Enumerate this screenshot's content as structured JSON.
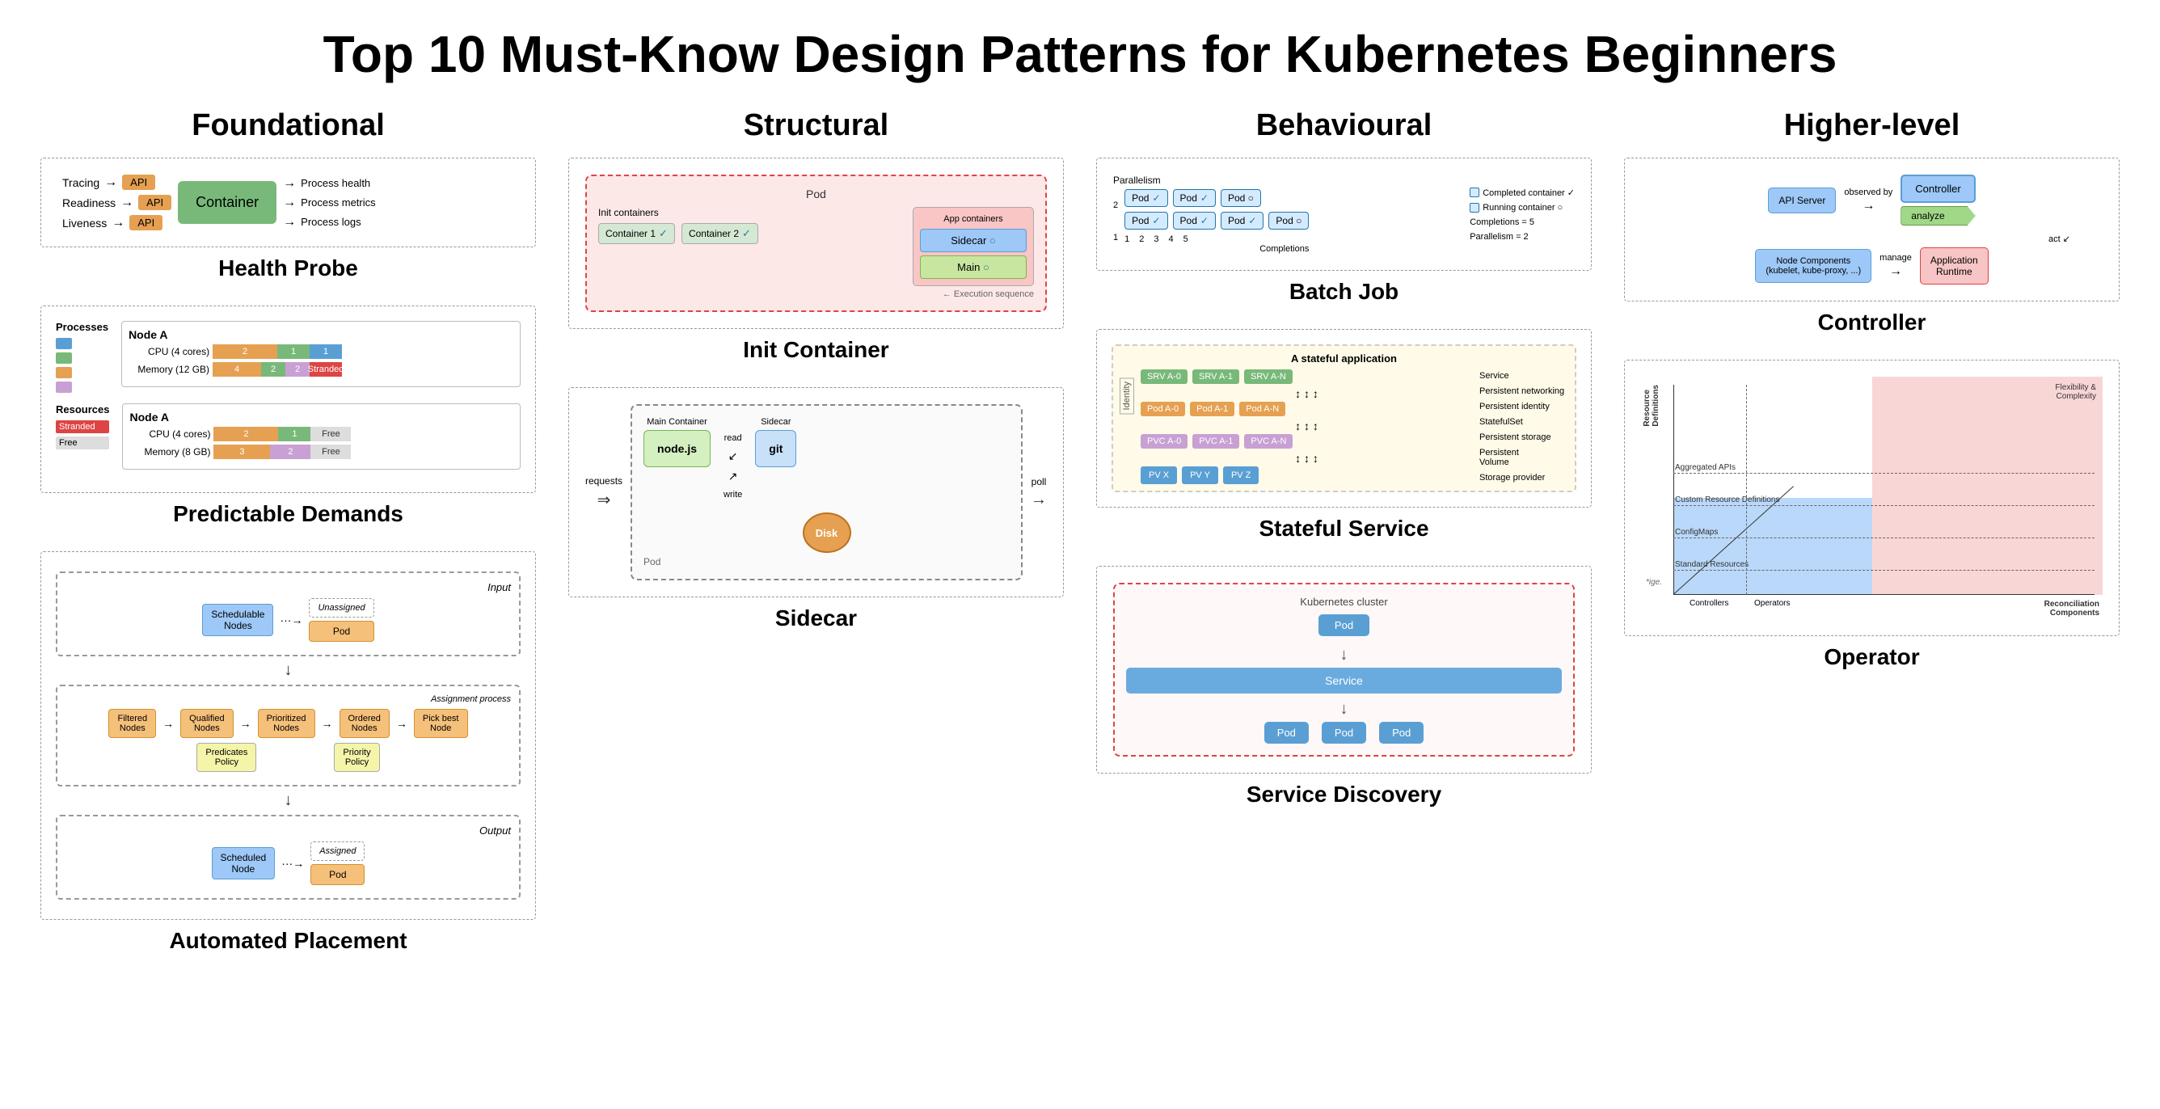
{
  "title": "Top 10 Must-Know Design Patterns for Kubernetes Beginners",
  "categories": [
    {
      "label": "Foundational"
    },
    {
      "label": "Structural"
    },
    {
      "label": "Behavioural"
    },
    {
      "label": "Higher-level"
    }
  ],
  "patterns": {
    "health_probe": {
      "title": "Health Probe",
      "probes": [
        "Tracing",
        "Readiness",
        "Liveness"
      ],
      "apis": [
        "API",
        "API",
        "API"
      ],
      "container_label": "Container",
      "right_labels": [
        "Process health",
        "Process metrics",
        "Process logs"
      ]
    },
    "predictable_demands": {
      "title": "Predictable Demands",
      "node_a1_title": "Node A",
      "node_a2_title": "Node A",
      "legend": [
        "Processes",
        "Resources",
        "Stranded",
        "Free"
      ],
      "cpu_label": "CPU (4 cores)",
      "mem12_label": "Memory (12 GB)",
      "mem8_label": "Memory (8 GB)"
    },
    "automated_placement": {
      "title": "Automated Placement",
      "input_label": "Input",
      "output_label": "Output",
      "schedulable_nodes": "Schedulable\nNodes",
      "unassigned": "Unassigned",
      "pod": "Pod",
      "assigned": "Assigned",
      "scheduled_node": "Scheduled\nNode",
      "filtered_nodes": "Filtered\nNodes",
      "qualified_nodes": "Qualified\nNodes",
      "prioritized_nodes": "Prioritized\nNodes",
      "ordered_nodes": "Ordered\nNodes",
      "pick_best_node": "Pick best\nNode",
      "predicates_policy": "Predicates\nPolicy",
      "priority_policy": "Priority\nPolicy",
      "assignment_process": "Assignment process"
    },
    "init_container": {
      "title": "Init Container",
      "pod_label": "Pod",
      "app_containers": "App\ncontainers",
      "sidecar_label": "Sidecar",
      "main_label": "Main",
      "init_containers": "Init containers",
      "container1": "Container 1",
      "container2": "Container 2",
      "exec_sequence": "Execution sequence"
    },
    "sidecar": {
      "title": "Sidecar",
      "pod_label": "Pod",
      "main_container": "Main Container",
      "nodejs": "node.js",
      "sidecar": "Sidecar",
      "git": "git",
      "disk": "Disk",
      "requests": "requests",
      "poll": "poll",
      "read": "read",
      "write": "write"
    },
    "batch_job": {
      "title": "Batch Job",
      "parallelism_label": "Parallelism",
      "completions_label": "Completions",
      "completed_container": "Completed container",
      "running_container": "Running container",
      "completions_eq": "Completions = 5",
      "parallelism_eq": "Parallelism = 2",
      "y_vals": [
        "2",
        "1"
      ],
      "x_vals": [
        "1",
        "2",
        "3",
        "4",
        "5"
      ],
      "x_label": "Completions"
    },
    "stateful_service": {
      "title": "Stateful Service",
      "app_title": "A stateful application",
      "identity_label": "Identity",
      "srv_labels": [
        "SRV A-0",
        "SRV A-1",
        "SRV A-N"
      ],
      "pod_labels": [
        "Pod A-0",
        "Pod A-1",
        "Pod A-N"
      ],
      "pvc_labels": [
        "PVC A-0",
        "PVC A-1",
        "PVC A-N"
      ],
      "pv_labels": [
        "PV X",
        "PV Y",
        "PV Z"
      ],
      "service_label": "Service",
      "persistent_networking": "Persistent networking",
      "persistent_identity": "Persistent identity",
      "stateful_set": "StatefulSet",
      "persistent_storage": "Persistent storage",
      "persistent_volume": "Persistent\nVolume",
      "storage_provider": "Storage provider"
    },
    "service_discovery": {
      "title": "Service Discovery",
      "cluster_label": "Kubernetes cluster",
      "pod_top": "Pod",
      "service_box": "Service",
      "pods": [
        "Pod",
        "Pod",
        "Pod"
      ]
    },
    "controller": {
      "title": "Controller",
      "api_server": "API Server",
      "observed_by": "observed by",
      "act": "act",
      "controller": "Controller",
      "analyze": "analyze",
      "node_components": "Node Components\n(kubelet, kube-proxy, ...)",
      "manage": "manage",
      "application_runtime": "Application\nRuntime"
    },
    "operator": {
      "title": "Operator",
      "x_label": "Reconciliation\nComponents",
      "y_label": "Resource\nDefinitions",
      "labels": [
        "Standard Resources",
        "ConfigMaps",
        "Custom Resource Definitions",
        "Aggregated APIs"
      ],
      "x_items": [
        "Controllers",
        "Operators"
      ],
      "flexibility_label": "Flexibility &\nComplexity",
      "attribution": "*ige."
    }
  }
}
